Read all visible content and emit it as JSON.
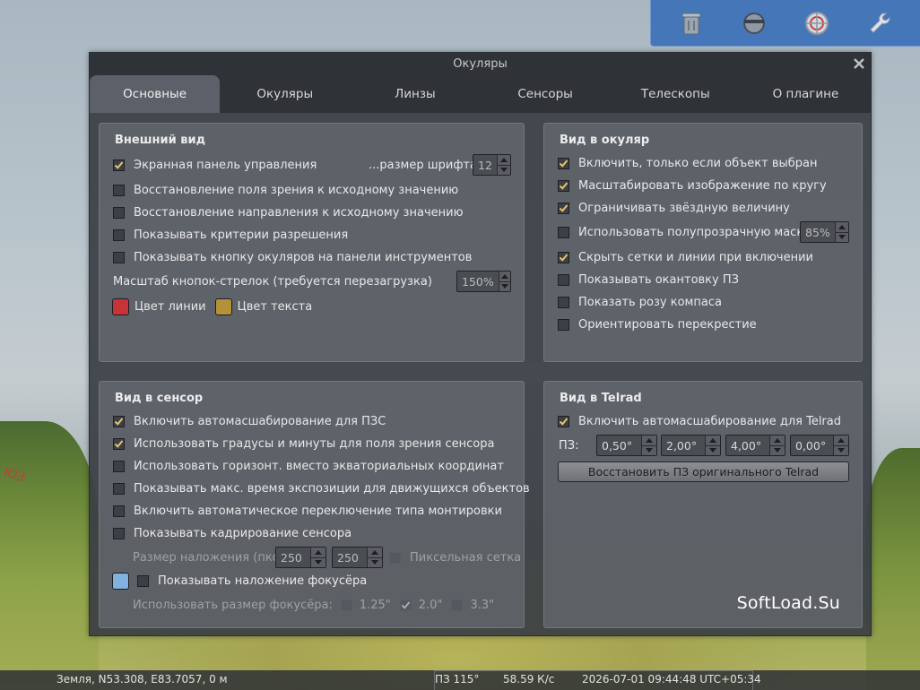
{
  "background": {
    "marker": "ЮЗ"
  },
  "toolbar": {
    "icons": [
      "trash-icon",
      "eyepiece-icon",
      "crosshair-icon",
      "wrench-icon"
    ]
  },
  "dialog": {
    "title": "Окуляры",
    "close_glyph": "✕",
    "tabs": [
      "Основные",
      "Окуляры",
      "Линзы",
      "Сенсоры",
      "Телескопы",
      "О плагине"
    ],
    "active_tab": "Основные"
  },
  "appearance": {
    "title": "Внешний вид",
    "onscreen_panel": {
      "label": "Экранная панель управления",
      "checked": true
    },
    "font_size_label": "...размер шрифта",
    "font_size_value": "12",
    "restore_fov": {
      "label": "Восстановление поля зрения к исходному значению",
      "checked": false
    },
    "restore_direction": {
      "label": "Восстановление направления к исходному значению",
      "checked": false
    },
    "show_resolution": {
      "label": "Показывать критерии разрешения",
      "checked": false
    },
    "show_toolbar_button": {
      "label": "Показывать кнопку окуляров на панели инструментов",
      "checked": false
    },
    "arrow_scale_label": "Масштаб кнопок-стрелок (требуется перезагрузка)",
    "arrow_scale_value": "150%",
    "line_color_label": "Цвет линии",
    "line_color": "#c8333a",
    "text_color_label": "Цвет текста",
    "text_color": "#b4923a"
  },
  "eyepiece_view": {
    "title": "Вид в окуляр",
    "only_if_selected": {
      "label": "Включить, только если объект выбран",
      "checked": true
    },
    "scale_circle": {
      "label": "Масштабировать изображение по кругу",
      "checked": true
    },
    "limit_magnitude": {
      "label": "Ограничивать звёздную величину",
      "checked": true
    },
    "semi_transparent": {
      "label": "Использовать полупрозрачную маску",
      "checked": false
    },
    "mask_value": "85%",
    "hide_grids": {
      "label": "Скрыть сетки и линии при включении",
      "checked": true
    },
    "show_fov_outline": {
      "label": "Показывать окантовку ПЗ",
      "checked": false
    },
    "show_compass": {
      "label": "Показать розу компаса",
      "checked": false
    },
    "orient_crosshair": {
      "label": "Ориентировать перекрестие",
      "checked": false
    }
  },
  "sensor_view": {
    "title": "Вид в сенсор",
    "auto_scale_ccd": {
      "label": "Включить автомасшабирование для ПЗС",
      "checked": true
    },
    "use_dms": {
      "label": "Использовать градусы и минуты для поля зрения сенсора",
      "checked": true
    },
    "use_horizontal": {
      "label": "Использовать горизонт. вместо экваториальных координат",
      "checked": false
    },
    "show_max_exposure": {
      "label": "Показывать макс. время экспозиции для движущихся объектов",
      "checked": false
    },
    "auto_mount_switch": {
      "label": "Включить автоматическое переключение типа монтировки",
      "checked": false
    },
    "show_crop": {
      "label": "Показывать кадрирование сенсора",
      "checked": false
    },
    "overlay_size_label": "Размер наложения (пкс)",
    "overlay_w": "250",
    "overlay_h": "250",
    "pixel_grid": {
      "label": "Пиксельная сетка",
      "checked": false
    },
    "focuser_color": "#7fb2e0",
    "show_focuser": {
      "label": "Показывать наложение фокусёра",
      "checked": false
    },
    "focuser_size_label": "Использовать размер фокусёра:",
    "focuser_sizes": [
      {
        "label": "1.25\"",
        "checked": false
      },
      {
        "label": "2.0\"",
        "checked": true
      },
      {
        "label": "3.3\"",
        "checked": false
      }
    ]
  },
  "telrad_view": {
    "title": "Вид в Telrad",
    "auto_scale_telrad": {
      "label": "Включить автомасшабирование для Telrad",
      "checked": true
    },
    "fov_label": "ПЗ:",
    "fov_values": [
      "0,50°",
      "2,00°",
      "4,00°",
      "0,00°"
    ],
    "restore_button": "Восстановить ПЗ оригинального Telrad"
  },
  "watermark": "SoftLoad.Su",
  "status": {
    "location": "Земля, N53.308, E83.7057, 0 м",
    "fov": "ПЗ 115°",
    "fps": "58.59 К/с",
    "datetime": "2026-07-01 09:44:48 UTC+05:34"
  }
}
